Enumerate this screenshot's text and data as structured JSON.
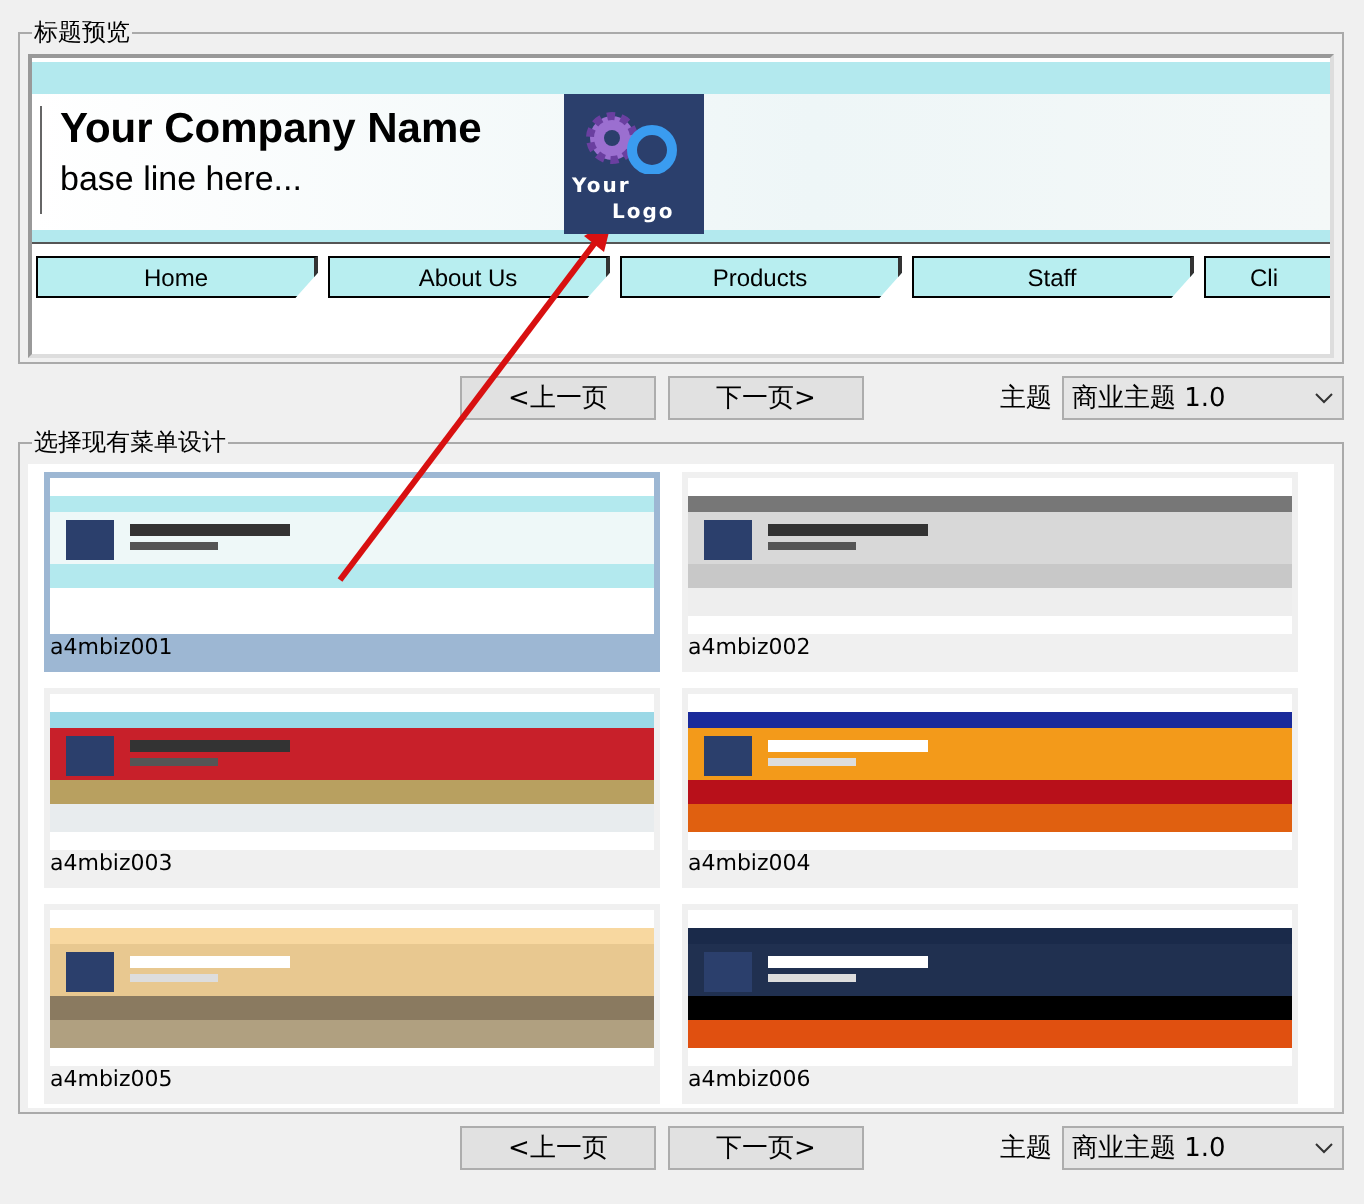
{
  "preview": {
    "title": "标题预览",
    "company_name": "Your Company Name",
    "base_line": "base line here...",
    "logo_text": [
      "Your",
      "Logo"
    ],
    "nav": [
      "Home",
      "About Us",
      "Products",
      "Staff",
      "Cli"
    ]
  },
  "pager_top": {
    "prev": "<上一页",
    "next": "下一页>",
    "theme_label": "主题",
    "theme_value": "商业主题 1.0"
  },
  "designs": {
    "title": "选择现有菜单设计",
    "items": [
      {
        "name": "a4mbiz001",
        "kind": "aqua",
        "selected": true
      },
      {
        "name": "a4mbiz002",
        "kind": "silver",
        "selected": false
      },
      {
        "name": "a4mbiz003",
        "kind": "photo",
        "selected": false
      },
      {
        "name": "a4mbiz004",
        "kind": "red",
        "selected": false
      },
      {
        "name": "a4mbiz005",
        "kind": "gold",
        "selected": false
      },
      {
        "name": "a4mbiz006",
        "kind": "dark",
        "selected": false
      }
    ]
  },
  "pager_bottom": {
    "prev": "<上一页",
    "next": "下一页>",
    "theme_label": "主题",
    "theme_value": "商业主题 1.0"
  }
}
